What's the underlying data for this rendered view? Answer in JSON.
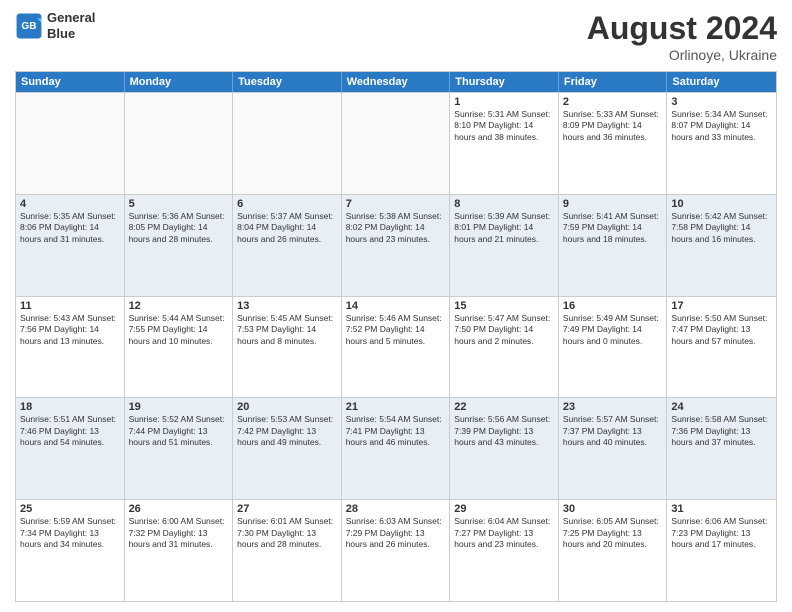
{
  "header": {
    "logo_line1": "General",
    "logo_line2": "Blue",
    "title": "August 2024",
    "subtitle": "Orlinoye, Ukraine"
  },
  "days_of_week": [
    "Sunday",
    "Monday",
    "Tuesday",
    "Wednesday",
    "Thursday",
    "Friday",
    "Saturday"
  ],
  "rows": [
    [
      {
        "day": "",
        "detail": ""
      },
      {
        "day": "",
        "detail": ""
      },
      {
        "day": "",
        "detail": ""
      },
      {
        "day": "",
        "detail": ""
      },
      {
        "day": "1",
        "detail": "Sunrise: 5:31 AM\nSunset: 8:10 PM\nDaylight: 14 hours\nand 38 minutes."
      },
      {
        "day": "2",
        "detail": "Sunrise: 5:33 AM\nSunset: 8:09 PM\nDaylight: 14 hours\nand 36 minutes."
      },
      {
        "day": "3",
        "detail": "Sunrise: 5:34 AM\nSunset: 8:07 PM\nDaylight: 14 hours\nand 33 minutes."
      }
    ],
    [
      {
        "day": "4",
        "detail": "Sunrise: 5:35 AM\nSunset: 8:06 PM\nDaylight: 14 hours\nand 31 minutes."
      },
      {
        "day": "5",
        "detail": "Sunrise: 5:36 AM\nSunset: 8:05 PM\nDaylight: 14 hours\nand 28 minutes."
      },
      {
        "day": "6",
        "detail": "Sunrise: 5:37 AM\nSunset: 8:04 PM\nDaylight: 14 hours\nand 26 minutes."
      },
      {
        "day": "7",
        "detail": "Sunrise: 5:38 AM\nSunset: 8:02 PM\nDaylight: 14 hours\nand 23 minutes."
      },
      {
        "day": "8",
        "detail": "Sunrise: 5:39 AM\nSunset: 8:01 PM\nDaylight: 14 hours\nand 21 minutes."
      },
      {
        "day": "9",
        "detail": "Sunrise: 5:41 AM\nSunset: 7:59 PM\nDaylight: 14 hours\nand 18 minutes."
      },
      {
        "day": "10",
        "detail": "Sunrise: 5:42 AM\nSunset: 7:58 PM\nDaylight: 14 hours\nand 16 minutes."
      }
    ],
    [
      {
        "day": "11",
        "detail": "Sunrise: 5:43 AM\nSunset: 7:56 PM\nDaylight: 14 hours\nand 13 minutes."
      },
      {
        "day": "12",
        "detail": "Sunrise: 5:44 AM\nSunset: 7:55 PM\nDaylight: 14 hours\nand 10 minutes."
      },
      {
        "day": "13",
        "detail": "Sunrise: 5:45 AM\nSunset: 7:53 PM\nDaylight: 14 hours\nand 8 minutes."
      },
      {
        "day": "14",
        "detail": "Sunrise: 5:46 AM\nSunset: 7:52 PM\nDaylight: 14 hours\nand 5 minutes."
      },
      {
        "day": "15",
        "detail": "Sunrise: 5:47 AM\nSunset: 7:50 PM\nDaylight: 14 hours\nand 2 minutes."
      },
      {
        "day": "16",
        "detail": "Sunrise: 5:49 AM\nSunset: 7:49 PM\nDaylight: 14 hours\nand 0 minutes."
      },
      {
        "day": "17",
        "detail": "Sunrise: 5:50 AM\nSunset: 7:47 PM\nDaylight: 13 hours\nand 57 minutes."
      }
    ],
    [
      {
        "day": "18",
        "detail": "Sunrise: 5:51 AM\nSunset: 7:46 PM\nDaylight: 13 hours\nand 54 minutes."
      },
      {
        "day": "19",
        "detail": "Sunrise: 5:52 AM\nSunset: 7:44 PM\nDaylight: 13 hours\nand 51 minutes."
      },
      {
        "day": "20",
        "detail": "Sunrise: 5:53 AM\nSunset: 7:42 PM\nDaylight: 13 hours\nand 49 minutes."
      },
      {
        "day": "21",
        "detail": "Sunrise: 5:54 AM\nSunset: 7:41 PM\nDaylight: 13 hours\nand 46 minutes."
      },
      {
        "day": "22",
        "detail": "Sunrise: 5:56 AM\nSunset: 7:39 PM\nDaylight: 13 hours\nand 43 minutes."
      },
      {
        "day": "23",
        "detail": "Sunrise: 5:57 AM\nSunset: 7:37 PM\nDaylight: 13 hours\nand 40 minutes."
      },
      {
        "day": "24",
        "detail": "Sunrise: 5:58 AM\nSunset: 7:36 PM\nDaylight: 13 hours\nand 37 minutes."
      }
    ],
    [
      {
        "day": "25",
        "detail": "Sunrise: 5:59 AM\nSunset: 7:34 PM\nDaylight: 13 hours\nand 34 minutes."
      },
      {
        "day": "26",
        "detail": "Sunrise: 6:00 AM\nSunset: 7:32 PM\nDaylight: 13 hours\nand 31 minutes."
      },
      {
        "day": "27",
        "detail": "Sunrise: 6:01 AM\nSunset: 7:30 PM\nDaylight: 13 hours\nand 28 minutes."
      },
      {
        "day": "28",
        "detail": "Sunrise: 6:03 AM\nSunset: 7:29 PM\nDaylight: 13 hours\nand 26 minutes."
      },
      {
        "day": "29",
        "detail": "Sunrise: 6:04 AM\nSunset: 7:27 PM\nDaylight: 13 hours\nand 23 minutes."
      },
      {
        "day": "30",
        "detail": "Sunrise: 6:05 AM\nSunset: 7:25 PM\nDaylight: 13 hours\nand 20 minutes."
      },
      {
        "day": "31",
        "detail": "Sunrise: 6:06 AM\nSunset: 7:23 PM\nDaylight: 13 hours\nand 17 minutes."
      }
    ]
  ],
  "alt_rows": [
    1,
    3
  ],
  "empty_cells_row0": [
    0,
    1,
    2,
    3
  ]
}
